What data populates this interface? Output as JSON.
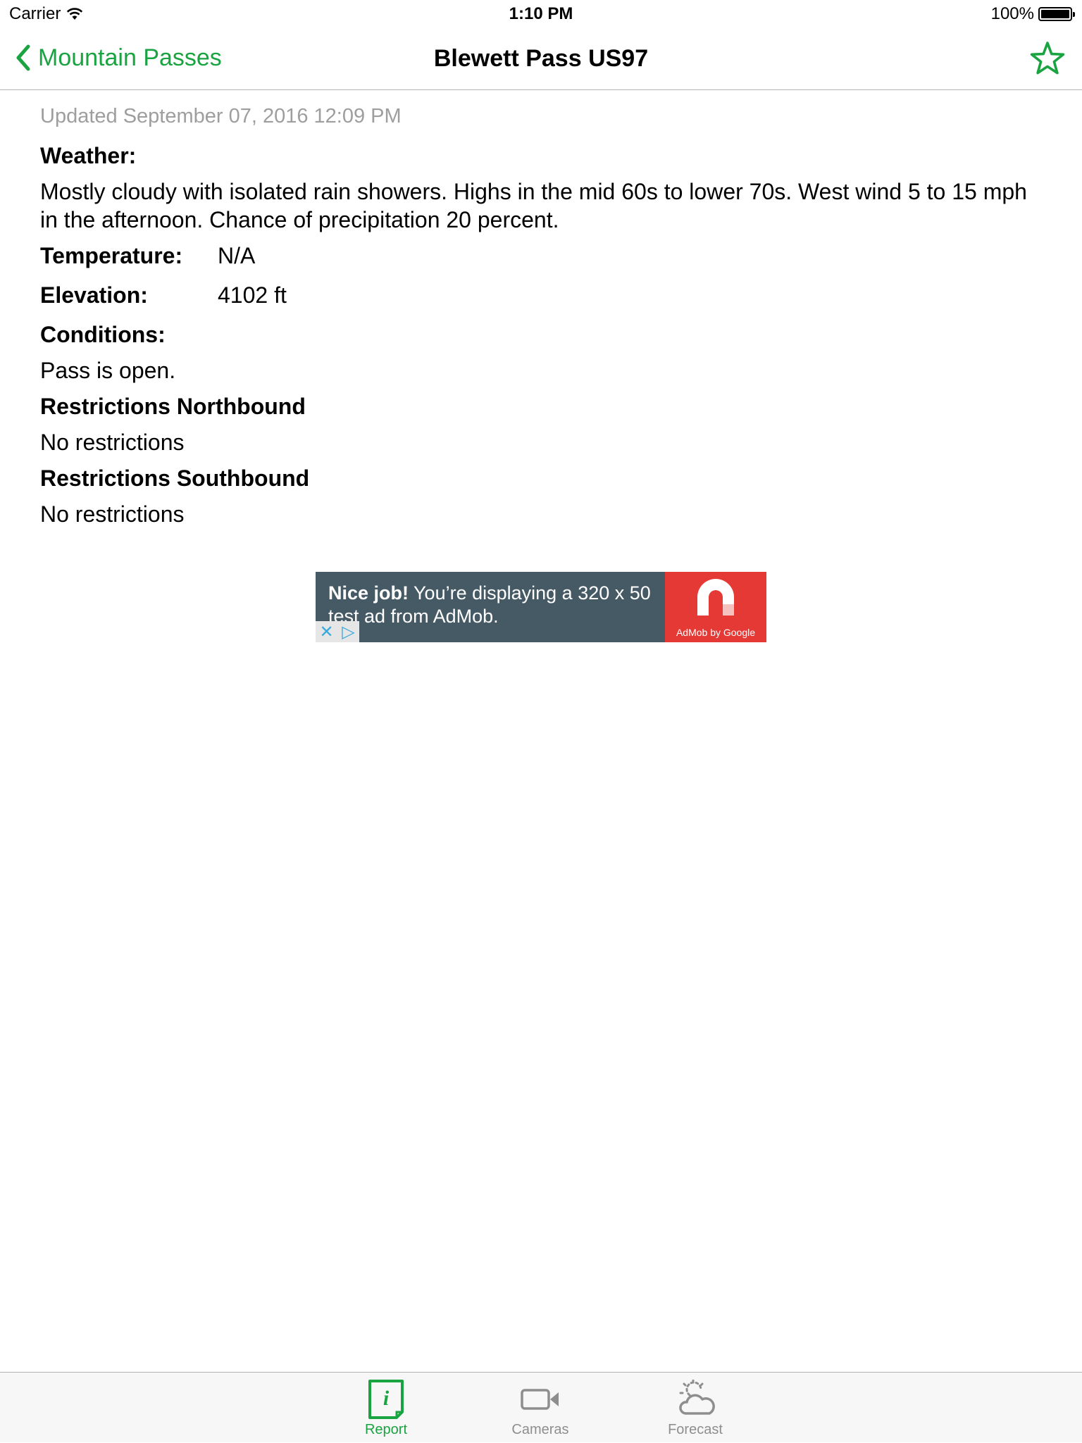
{
  "status_bar": {
    "carrier": "Carrier",
    "time": "1:10 PM",
    "battery": "100%",
    "battery_level": 1.0
  },
  "nav": {
    "back_label": "Mountain Passes",
    "title": "Blewett Pass US97",
    "favorite_icon": "star-outline-icon",
    "accent_color": "#1aa341"
  },
  "report": {
    "updated": "Updated September 07, 2016 12:09 PM",
    "weather_label": "Weather:",
    "weather_text": "Mostly cloudy with isolated rain showers. Highs in the mid 60s to lower 70s. West wind 5 to 15 mph in the afternoon. Chance of precipitation 20 percent.",
    "temperature_label": "Temperature:",
    "temperature_value": "N/A",
    "elevation_label": "Elevation:",
    "elevation_value": "4102 ft",
    "conditions_label": "Conditions:",
    "conditions_text": "Pass is open.",
    "northbound_label": "Restrictions Northbound",
    "northbound_text": "No restrictions",
    "southbound_label": "Restrictions Southbound",
    "southbound_text": "No restrictions"
  },
  "ad": {
    "headline": "Nice job!",
    "body": "You’re displaying a 320 x 50 test ad from AdMob.",
    "brand": "AdMob by Google",
    "bg_color": "#465a66",
    "logo_color": "#e53935"
  },
  "tabs": [
    {
      "label": "Report",
      "icon": "report-info-icon",
      "active": true
    },
    {
      "label": "Cameras",
      "icon": "video-camera-icon",
      "active": false
    },
    {
      "label": "Forecast",
      "icon": "partly-cloudy-icon",
      "active": false
    }
  ]
}
